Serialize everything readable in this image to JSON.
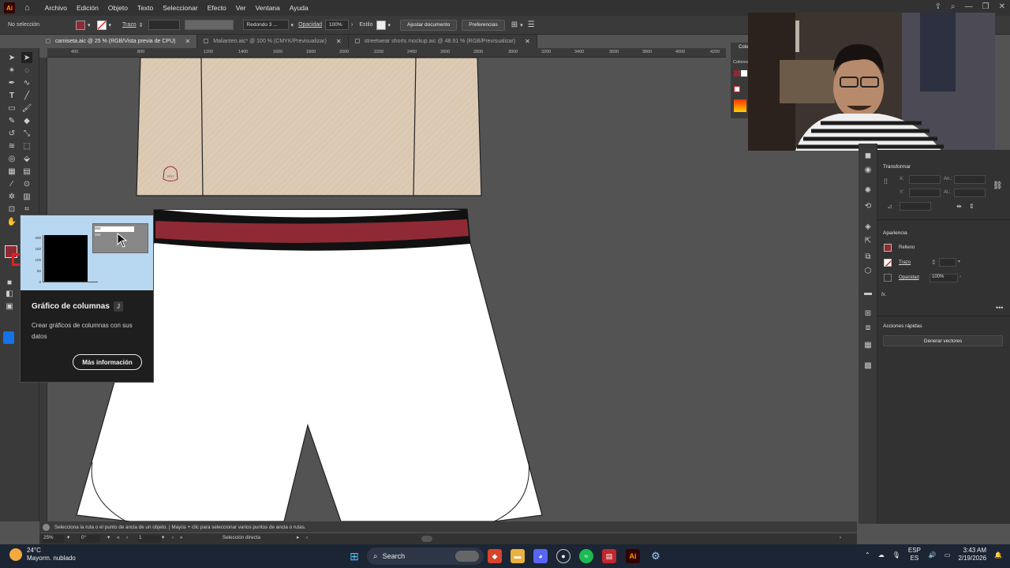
{
  "menubar": {
    "logo": "Ai",
    "items": [
      "Archivo",
      "Edición",
      "Objeto",
      "Texto",
      "Seleccionar",
      "Efecto",
      "Ver",
      "Ventana",
      "Ayuda"
    ]
  },
  "control": {
    "selection": "No selección",
    "stroke_label": "Trazo",
    "brush": "Redondo 3 ...",
    "opacity_label": "Opacidad",
    "opacity_value": "100%",
    "style_label": "Estilo",
    "adjust_button": "Ajustar documento",
    "prefs_button": "Preferencias",
    "fill_color": "#8f2a35"
  },
  "tabs": [
    {
      "label": "camiseta.aic @ 25 % (RGB/Vista previa de CPU)",
      "active": true
    },
    {
      "label": "Malianteo.aic* @ 100 % (CMYK/Previsualizar)",
      "active": false
    },
    {
      "label": "streetwear shorts mockup.aic @ 48.91 % (RGB/Previsualizar)",
      "active": false
    }
  ],
  "ruler": {
    "ticks": [
      "400",
      "800",
      "1200",
      "1400",
      "1600",
      "1800",
      "2000",
      "2200",
      "2400",
      "2600",
      "2800",
      "3000",
      "3200",
      "3400",
      "3600",
      "3800",
      "4000",
      "4200"
    ]
  },
  "tooltip": {
    "title": "Gráfico de columnas",
    "shortcut": "J",
    "description": "Crear gráficos de columnas con sus datos",
    "more_button": "Más información",
    "preview_axis": [
      "200",
      "150",
      "100",
      "50",
      "0"
    ],
    "preview_cells": [
      "300",
      "300"
    ]
  },
  "artwork": {
    "tag_text": "TEXT",
    "waistband_color": "#8f2a35",
    "fabric_color": "#dccab4"
  },
  "color_panel": {
    "title": "Colo",
    "subtitle": "Colores"
  },
  "properties": {
    "transform_title": "Transformar",
    "x_label": "X:",
    "y_label": "Y:",
    "w_label": "An.:",
    "h_label": "Al.:",
    "appearance_title": "Apariencia",
    "fill_label": "Relleno",
    "stroke_label": "Trazo",
    "opacity_label": "Opacidad",
    "opacity_value": "100%",
    "fx_label": "fx.",
    "quick_actions_title": "Acciones rápidas",
    "generate_button": "Generar vectores"
  },
  "status": {
    "hint": "Selecciona la ruta o el punto de ancla de un objeto.  |  Mayús + clic para seleccionar varios puntos de ancla o rutas.",
    "zoom": "25%",
    "rotation": "0°",
    "artboard": "1",
    "tool": "Selección directa"
  },
  "taskbar": {
    "temperature": "24°C",
    "weather": "Mayorm. nublado",
    "search": "Search",
    "language": "ESP",
    "region": "ES",
    "time": "3:43 AM",
    "date": "2/19/2026"
  }
}
